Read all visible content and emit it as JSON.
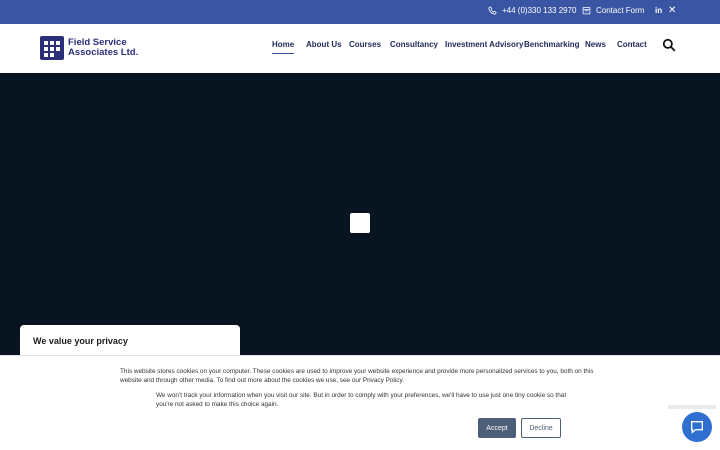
{
  "topbar": {
    "phone": "+44 (0)330 133 2970",
    "contact_form": "Contact Form",
    "social_linkedin": "in",
    "social_x": "✕"
  },
  "brand": {
    "line1": "Field Service",
    "line2": "Associates Ltd."
  },
  "nav": {
    "home": "Home",
    "about": "About Us",
    "courses": "Courses",
    "consultancy": "Consultancy",
    "investment": "Investment Advisory",
    "benchmarking": "Benchmarking",
    "news": "News",
    "contact": "Contact"
  },
  "privacy": {
    "title": "We value your privacy"
  },
  "cookie": {
    "text1": "This website stores cookies on your computer. These cookies are used to improve your website experience and provide more personalized services to you, both on this website and through other media. To find out more about the cookies we use, see our Privacy Policy.",
    "text2": "We won't track your information when you visit our site. But in order to comply with your preferences, we'll have to use just one tiny cookie so that you're not asked to make this choice again.",
    "accept": "Accept",
    "decline": "Decline"
  },
  "colors": {
    "topbar": "#3a55a4",
    "brand": "#2b2f7a",
    "hero": "#081520",
    "accept": "#4d5f78",
    "chat": "#2f6fd0"
  },
  "icons": {
    "phone": "phone-icon",
    "form": "calendar-form-icon",
    "search": "search-icon",
    "chat": "chat-icon"
  }
}
